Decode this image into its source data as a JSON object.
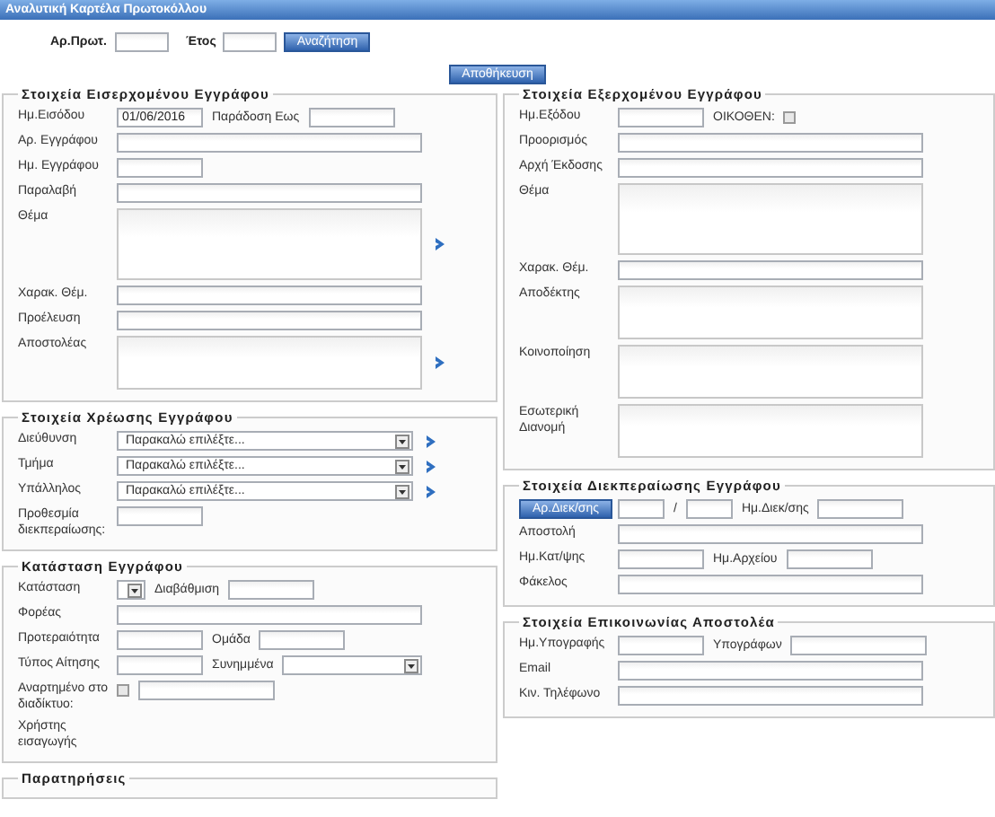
{
  "window": {
    "title": "Αναλυτική Καρτέλα Πρωτοκόλλου"
  },
  "search": {
    "fields": [
      {
        "label": "Αρ.Πρωτ."
      },
      {
        "label": "Έτος"
      }
    ],
    "button": "Αναζήτηση"
  },
  "save_button": "Αποθήκευση",
  "columns": [
    {
      "sections": [
        {
          "title": "Στοιχεία Εισερχομένου Εγγράφου",
          "rows": [
            {
              "kind": "plain",
              "label": "Ημ.Εισόδου",
              "arrow": false,
              "items": [
                {
                  "kind": "short",
                  "value": "01/06/2016"
                },
                {
                  "kind": "caption",
                  "text": "Παράδοση Εως"
                },
                {
                  "kind": "short"
                }
              ]
            },
            {
              "kind": "plain",
              "label": "Αρ. Εγγράφου",
              "arrow": false,
              "items": [
                {
                  "kind": "long"
                }
              ]
            },
            {
              "kind": "plain",
              "label": "Ημ. Εγγράφου",
              "arrow": false,
              "items": [
                {
                  "kind": "short"
                }
              ]
            },
            {
              "kind": "plain",
              "label": "Παραλαβή",
              "arrow": false,
              "items": [
                {
                  "kind": "long"
                }
              ]
            },
            {
              "kind": "plain",
              "label": "Θέμα",
              "arrow": true,
              "items": [
                {
                  "kind": "area-tall"
                }
              ]
            },
            {
              "kind": "plain",
              "label": "Χαρακ. Θέμ.",
              "arrow": false,
              "items": [
                {
                  "kind": "long"
                }
              ]
            },
            {
              "kind": "plain",
              "label": "Προέλευση",
              "arrow": false,
              "items": [
                {
                  "kind": "long"
                }
              ]
            },
            {
              "kind": "plain",
              "label": "Αποστολέας",
              "arrow": true,
              "items": [
                {
                  "kind": "area"
                }
              ]
            }
          ]
        },
        {
          "title": "Στοιχεία Χρέωσης Εγγράφου",
          "rows": [
            {
              "kind": "plain",
              "label": "Διεύθυνση",
              "arrow": true,
              "items": [
                {
                  "kind": "select",
                  "value": "Παρακαλώ επιλέξτε..."
                }
              ]
            },
            {
              "kind": "plain",
              "label": "Τμήμα",
              "arrow": true,
              "items": [
                {
                  "kind": "select",
                  "value": "Παρακαλώ επιλέξτε..."
                }
              ]
            },
            {
              "kind": "plain",
              "label": "Υπάλληλος",
              "arrow": true,
              "items": [
                {
                  "kind": "select",
                  "value": "Παρακαλώ επιλέξτε..."
                }
              ]
            },
            {
              "kind": "plain",
              "label": "Προθεσμία διεκπεραίωσης:",
              "arrow": false,
              "items": [
                {
                  "kind": "short"
                }
              ]
            }
          ]
        },
        {
          "title": "Κατάσταση Εγγράφου",
          "rows": [
            {
              "kind": "plain",
              "label": "Κατάσταση",
              "arrow": false,
              "items": [
                {
                  "kind": "mini-select"
                },
                {
                  "kind": "caption",
                  "text": "Διαβάθμιση"
                },
                {
                  "kind": "short"
                }
              ]
            },
            {
              "kind": "plain",
              "label": "Φορέας",
              "arrow": false,
              "items": [
                {
                  "kind": "long"
                }
              ]
            },
            {
              "kind": "plain",
              "label": "Προτεραιότητα",
              "arrow": false,
              "items": [
                {
                  "kind": "short"
                },
                {
                  "kind": "caption",
                  "text": "Ομάδα"
                },
                {
                  "kind": "short"
                }
              ]
            },
            {
              "kind": "plain",
              "label": "Τύπος Αίτησης",
              "arrow": false,
              "items": [
                {
                  "kind": "short"
                },
                {
                  "kind": "caption",
                  "text": "Συνημμένα"
                },
                {
                  "kind": "select-mid"
                }
              ]
            },
            {
              "kind": "plain",
              "label": "Αναρτημένο στο διαδίκτυο:",
              "arrow": false,
              "items": [
                {
                  "kind": "check",
                  "checked": false
                },
                {
                  "kind": "medium"
                }
              ]
            },
            {
              "kind": "plain",
              "label": "Χρήστης εισαγωγής",
              "arrow": false,
              "items": []
            }
          ]
        },
        {
          "title": "Παρατηρήσεις"
        }
      ]
    },
    {
      "sections": [
        {
          "title": "Στοιχεία Εξερχομένου Εγγράφου",
          "rows": [
            {
              "kind": "plain",
              "label": "Ημ.Εξόδου",
              "arrow": false,
              "items": [
                {
                  "kind": "short"
                },
                {
                  "kind": "caption",
                  "text": "ΟΙΚΟΘΕΝ:"
                },
                {
                  "kind": "check",
                  "checked": false
                }
              ]
            },
            {
              "kind": "plain",
              "label": "Προορισμός",
              "arrow": false,
              "items": [
                {
                  "kind": "long"
                }
              ]
            },
            {
              "kind": "plain",
              "label": "Αρχή Έκδοσης",
              "arrow": false,
              "items": [
                {
                  "kind": "long"
                }
              ]
            },
            {
              "kind": "plain",
              "label": "Θέμα",
              "arrow": false,
              "items": [
                {
                  "kind": "area-tall"
                }
              ]
            },
            {
              "kind": "plain",
              "label": "Χαρακ. Θέμ.",
              "arrow": false,
              "items": [
                {
                  "kind": "long"
                }
              ]
            },
            {
              "kind": "plain",
              "label": "Αποδέκτης",
              "arrow": false,
              "items": [
                {
                  "kind": "area"
                }
              ]
            },
            {
              "kind": "plain",
              "label": "Κοινοποίηση",
              "arrow": false,
              "items": [
                {
                  "kind": "area"
                }
              ]
            },
            {
              "kind": "plain",
              "label": "Εσωτερική Διανομή",
              "arrow": false,
              "items": [
                {
                  "kind": "area"
                }
              ]
            }
          ]
        },
        {
          "title": "Στοιχεία Διεκπεραίωσης Εγγράφου",
          "rows": [
            {
              "kind": "button",
              "label": "Αρ.Διεκ/σης",
              "arrow": false,
              "items": [
                {
                  "kind": "tiny"
                },
                {
                  "kind": "caption",
                  "text": "/"
                },
                {
                  "kind": "tiny"
                },
                {
                  "kind": "caption",
                  "text": "Ημ.Διεκ/σης"
                },
                {
                  "kind": "short"
                }
              ]
            },
            {
              "kind": "plain",
              "label": "Αποστολή",
              "arrow": false,
              "items": [
                {
                  "kind": "long"
                }
              ]
            },
            {
              "kind": "plain",
              "label": "Ημ.Κατ/ψης",
              "arrow": false,
              "items": [
                {
                  "kind": "short"
                },
                {
                  "kind": "caption",
                  "text": "Ημ.Αρχείου"
                },
                {
                  "kind": "short"
                }
              ]
            },
            {
              "kind": "plain",
              "label": "Φάκελος",
              "arrow": false,
              "items": [
                {
                  "kind": "long"
                }
              ]
            }
          ]
        },
        {
          "title": "Στοιχεία Επικοινωνίας Αποστολέα",
          "rows": [
            {
              "kind": "plain",
              "label": "Ημ.Υπογραφής",
              "arrow": false,
              "items": [
                {
                  "kind": "short"
                },
                {
                  "kind": "caption",
                  "text": "Υπογράφων"
                },
                {
                  "kind": "medium"
                }
              ]
            },
            {
              "kind": "plain",
              "label": "Email",
              "arrow": false,
              "items": [
                {
                  "kind": "long"
                }
              ]
            },
            {
              "kind": "plain",
              "label": "Κιν. Τηλέφωνο",
              "arrow": false,
              "items": [
                {
                  "kind": "long"
                }
              ]
            }
          ]
        }
      ]
    }
  ]
}
